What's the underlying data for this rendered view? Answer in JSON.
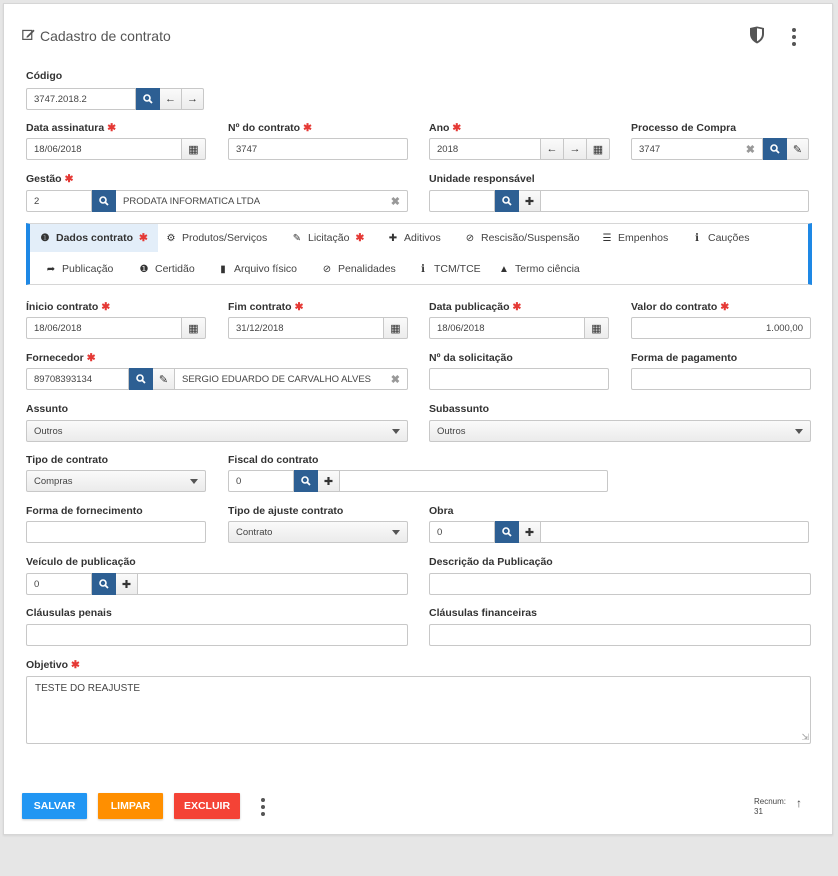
{
  "header": {
    "title": "Cadastro de contrato"
  },
  "codigo": {
    "label": "Código",
    "value": "3747.2018.2"
  },
  "data_assinatura": {
    "label": "Data assinatura",
    "value": "18/06/2018"
  },
  "numero_contrato": {
    "label": "Nº do contrato",
    "value": "3747"
  },
  "ano": {
    "label": "Ano",
    "value": "2018"
  },
  "processo_compra": {
    "label": "Processo de Compra",
    "value": "3747"
  },
  "gestao": {
    "label": "Gestão",
    "code": "2",
    "name": "PRODATA INFORMATICA LTDA"
  },
  "unidade_responsavel": {
    "label": "Unidade responsável",
    "code": "",
    "name": ""
  },
  "tabs": [
    {
      "label": "Dados contrato",
      "icon": "info-icon",
      "active": true,
      "required": true
    },
    {
      "label": "Produtos/Serviços",
      "icon": "gear-icon"
    },
    {
      "label": "Licitação",
      "icon": "edit-icon",
      "required": true
    },
    {
      "label": "Aditivos",
      "icon": "plus-icon"
    },
    {
      "label": "Rescisão/Suspensão",
      "icon": "ban-icon"
    },
    {
      "label": "Empenhos",
      "icon": "list-icon"
    },
    {
      "label": "Cauções",
      "icon": "info-i-icon"
    },
    {
      "label": "Publicação",
      "icon": "share-icon"
    },
    {
      "label": "Certidão",
      "icon": "info-icon"
    },
    {
      "label": "Arquivo físico",
      "icon": "file-icon"
    },
    {
      "label": "Penalidades",
      "icon": "ban-icon"
    },
    {
      "label": "TCM/TCE",
      "icon": "info-i-icon"
    },
    {
      "label": "Termo ciência",
      "icon": "flask-icon"
    }
  ],
  "inicio_contrato": {
    "label": "Ínicio contrato",
    "value": "18/06/2018"
  },
  "fim_contrato": {
    "label": "Fim contrato",
    "value": "31/12/2018"
  },
  "data_publicacao": {
    "label": "Data publicação",
    "value": "18/06/2018"
  },
  "valor_contrato": {
    "label": "Valor do contrato",
    "value": "1.000,00"
  },
  "fornecedor": {
    "label": "Fornecedor",
    "code": "89708393134",
    "name": "SERGIO EDUARDO DE CARVALHO ALVES"
  },
  "numero_solicitacao": {
    "label": "Nº da solicitação",
    "value": ""
  },
  "forma_pagamento": {
    "label": "Forma de pagamento",
    "value": ""
  },
  "assunto": {
    "label": "Assunto",
    "value": "Outros"
  },
  "subassunto": {
    "label": "Subassunto",
    "value": "Outros"
  },
  "tipo_contrato": {
    "label": "Tipo de contrato",
    "value": "Compras"
  },
  "fiscal_contrato": {
    "label": "Fiscal do contrato",
    "code": "0",
    "name": ""
  },
  "forma_fornecimento": {
    "label": "Forma de fornecimento",
    "value": ""
  },
  "tipo_ajuste": {
    "label": "Tipo de ajuste contrato",
    "value": "Contrato"
  },
  "obra": {
    "label": "Obra",
    "code": "0",
    "name": ""
  },
  "veiculo_publicacao": {
    "label": "Veículo de publicação",
    "code": "0",
    "name": ""
  },
  "descricao_publicacao": {
    "label": "Descrição da Publicação",
    "value": ""
  },
  "clausulas_penais": {
    "label": "Cláusulas penais",
    "value": ""
  },
  "clausulas_financeiras": {
    "label": "Cláusulas financeiras",
    "value": ""
  },
  "objetivo": {
    "label": "Objetivo",
    "value": "TESTE DO REAJUSTE"
  },
  "actions": {
    "save": "SALVAR",
    "clear": "LIMPAR",
    "delete": "EXCLUIR"
  },
  "recnum": {
    "label": "Recnum:",
    "value": "31"
  },
  "colors": {
    "primary_blue": "#2d5f93",
    "tab_accent": "#1e88e5",
    "save": "#2196f3",
    "clear": "#ff8f00",
    "delete": "#f44336",
    "required": "#e53935"
  }
}
